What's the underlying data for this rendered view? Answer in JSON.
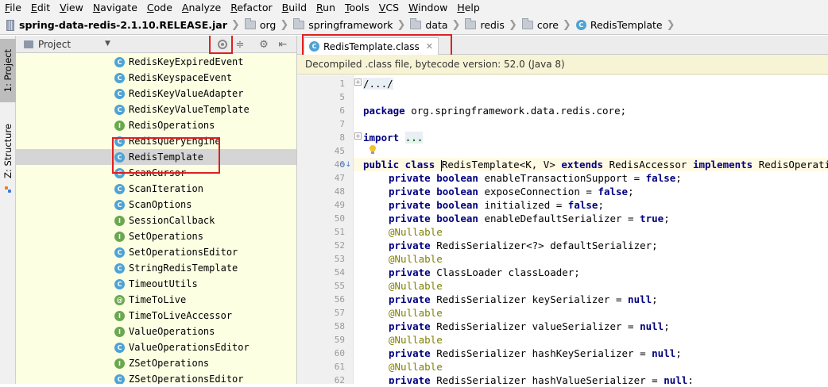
{
  "menu": [
    "File",
    "Edit",
    "View",
    "Navigate",
    "Code",
    "Analyze",
    "Refactor",
    "Build",
    "Run",
    "Tools",
    "VCS",
    "Window",
    "Help"
  ],
  "breadcrumb": [
    "spring-data-redis-2.1.10.RELEASE.jar",
    "org",
    "springframework",
    "data",
    "redis",
    "core",
    "RedisTemplate"
  ],
  "sidebar": {
    "project_tab": "1: Project",
    "structure_tab": "Z: Structure"
  },
  "project_panel": {
    "title": "Project",
    "items": [
      {
        "name": "RedisKeyExpiredEvent",
        "kind": "C"
      },
      {
        "name": "RedisKeyspaceEvent",
        "kind": "C"
      },
      {
        "name": "RedisKeyValueAdapter",
        "kind": "C"
      },
      {
        "name": "RedisKeyValueTemplate",
        "kind": "C"
      },
      {
        "name": "RedisOperations",
        "kind": "I"
      },
      {
        "name": "RedisQueryEngine",
        "kind": "C"
      },
      {
        "name": "RedisTemplate",
        "kind": "C"
      },
      {
        "name": "ScanCursor",
        "kind": "C"
      },
      {
        "name": "ScanIteration",
        "kind": "C"
      },
      {
        "name": "ScanOptions",
        "kind": "C"
      },
      {
        "name": "SessionCallback",
        "kind": "I"
      },
      {
        "name": "SetOperations",
        "kind": "I"
      },
      {
        "name": "SetOperationsEditor",
        "kind": "C"
      },
      {
        "name": "StringRedisTemplate",
        "kind": "C"
      },
      {
        "name": "TimeoutUtils",
        "kind": "C"
      },
      {
        "name": "TimeToLive",
        "kind": "@"
      },
      {
        "name": "TimeToLiveAccessor",
        "kind": "I"
      },
      {
        "name": "ValueOperations",
        "kind": "I"
      },
      {
        "name": "ValueOperationsEditor",
        "kind": "C"
      },
      {
        "name": "ZSetOperations",
        "kind": "I"
      },
      {
        "name": "ZSetOperationsEditor",
        "kind": "C"
      }
    ]
  },
  "editor": {
    "tab_label": "RedisTemplate.class",
    "banner": "Decompiled .class file, bytecode version: 52.0 (Java 8)",
    "line_numbers": [
      "1",
      "5",
      "6",
      "7",
      "8",
      "45",
      "46",
      "47",
      "48",
      "49",
      "50",
      "51",
      "52",
      "53",
      "54",
      "55",
      "56",
      "57",
      "58",
      "59",
      "60",
      "61",
      "62"
    ],
    "code": {
      "l1": "/.../",
      "l6_kw": "package",
      "l6_rest": " org.springframework.data.redis.core;",
      "l8_kw": "import",
      "l8_fold": "...",
      "l46_kw1": "public class",
      "l46_name": "RedisTemplate",
      "l46_gen": "<K, V> ",
      "l46_kw2": "extends",
      "l46_base": " RedisAccessor ",
      "l46_kw3": "implements",
      "l46_iface": " RedisOperations<K, V>, BeanClassLoaderAware {",
      "l47": "enableTransactionSupport = ",
      "l48": "exposeConnection = ",
      "l49": "initialized = ",
      "l50": "enableDefaultSerializer = ",
      "l51": "@Nullable",
      "l52": "RedisSerializer<?> defaultSerializer;",
      "l54": "ClassLoader classLoader;",
      "l56": "RedisSerializer keySerializer = ",
      "l58": "RedisSerializer valueSerializer = ",
      "l60": "RedisSerializer hashKeySerializer = ",
      "l62": "RedisSerializer hashValueSerializer = ",
      "kw_private": "private",
      "kw_boolean": "boolean",
      "kw_false": "false",
      "kw_true": "true",
      "kw_null": "null",
      "semi": ";"
    }
  },
  "colors": {
    "highlight": "#e0201f",
    "panel_bg": "#fcffe2",
    "keyword": "#000080"
  }
}
